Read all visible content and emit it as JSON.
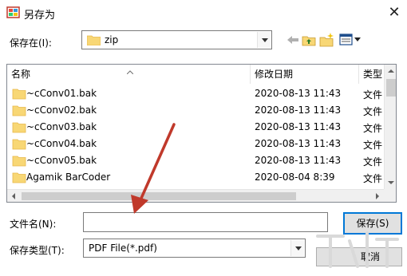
{
  "window": {
    "title": "另存为",
    "close_glyph": "✕"
  },
  "location": {
    "label": "保存在(I):",
    "value": "zip"
  },
  "toolbar": {
    "icons": [
      "back-arrow-icon",
      "up-folder-icon",
      "new-folder-icon",
      "view-menu-icon"
    ]
  },
  "file_list": {
    "columns": [
      "名称",
      "修改日期",
      "类型"
    ],
    "rows": [
      {
        "name": "~cConv01.bak",
        "date": "2020-08-13 11:43",
        "type": "文件"
      },
      {
        "name": "~cConv02.bak",
        "date": "2020-08-13 11:43",
        "type": "文件"
      },
      {
        "name": "~cConv03.bak",
        "date": "2020-08-13 11:43",
        "type": "文件"
      },
      {
        "name": "~cConv04.bak",
        "date": "2020-08-13 11:43",
        "type": "文件"
      },
      {
        "name": "~cConv05.bak",
        "date": "2020-08-13 11:43",
        "type": "文件"
      },
      {
        "name": "Agamik BarCoder",
        "date": "2020-08-04 8:39",
        "type": "文件"
      }
    ]
  },
  "filename": {
    "label": "文件名(N):",
    "value": ""
  },
  "filetype": {
    "label": "保存类型(T):",
    "value": "PDF File(*.pdf)"
  },
  "buttons": {
    "save": "保存(S)",
    "cancel": "取消"
  },
  "colors": {
    "folder": "#f8d775",
    "folder_dark": "#e6b84a",
    "accent": "#0078d7",
    "arrow": "#c0392b"
  }
}
